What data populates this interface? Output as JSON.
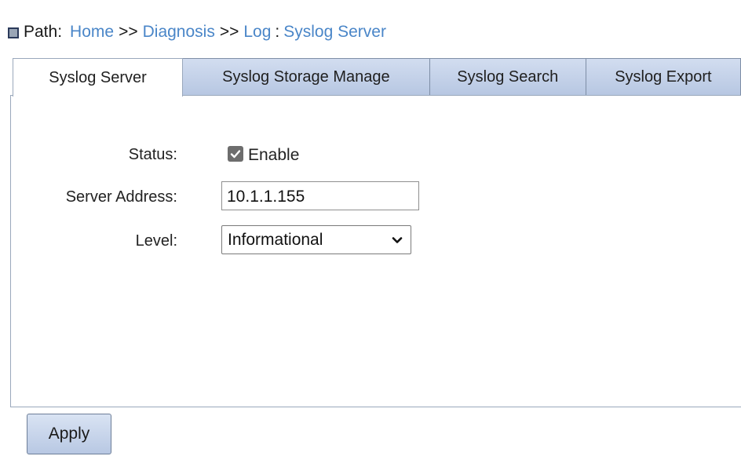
{
  "breadcrumb": {
    "label": "Path:",
    "items": [
      "Home",
      "Diagnosis",
      "Log",
      "Syslog Server"
    ],
    "separators": [
      ">>",
      ">>",
      ":"
    ]
  },
  "tabs": [
    {
      "label": "Syslog Server",
      "active": true
    },
    {
      "label": "Syslog Storage Manage",
      "active": false
    },
    {
      "label": "Syslog Search",
      "active": false
    },
    {
      "label": "Syslog Export",
      "active": false
    }
  ],
  "form": {
    "status": {
      "label": "Status:",
      "checkbox_label": "Enable",
      "checked": true
    },
    "server_address": {
      "label": "Server Address:",
      "value": "10.1.1.155"
    },
    "level": {
      "label": "Level:",
      "value": "Informational"
    }
  },
  "apply_label": "Apply",
  "colors": {
    "link": "#4a86c8",
    "tab_bg": "#c4d2ea",
    "border": "#9aa8bc",
    "checkbox": "#6d6d6d"
  }
}
